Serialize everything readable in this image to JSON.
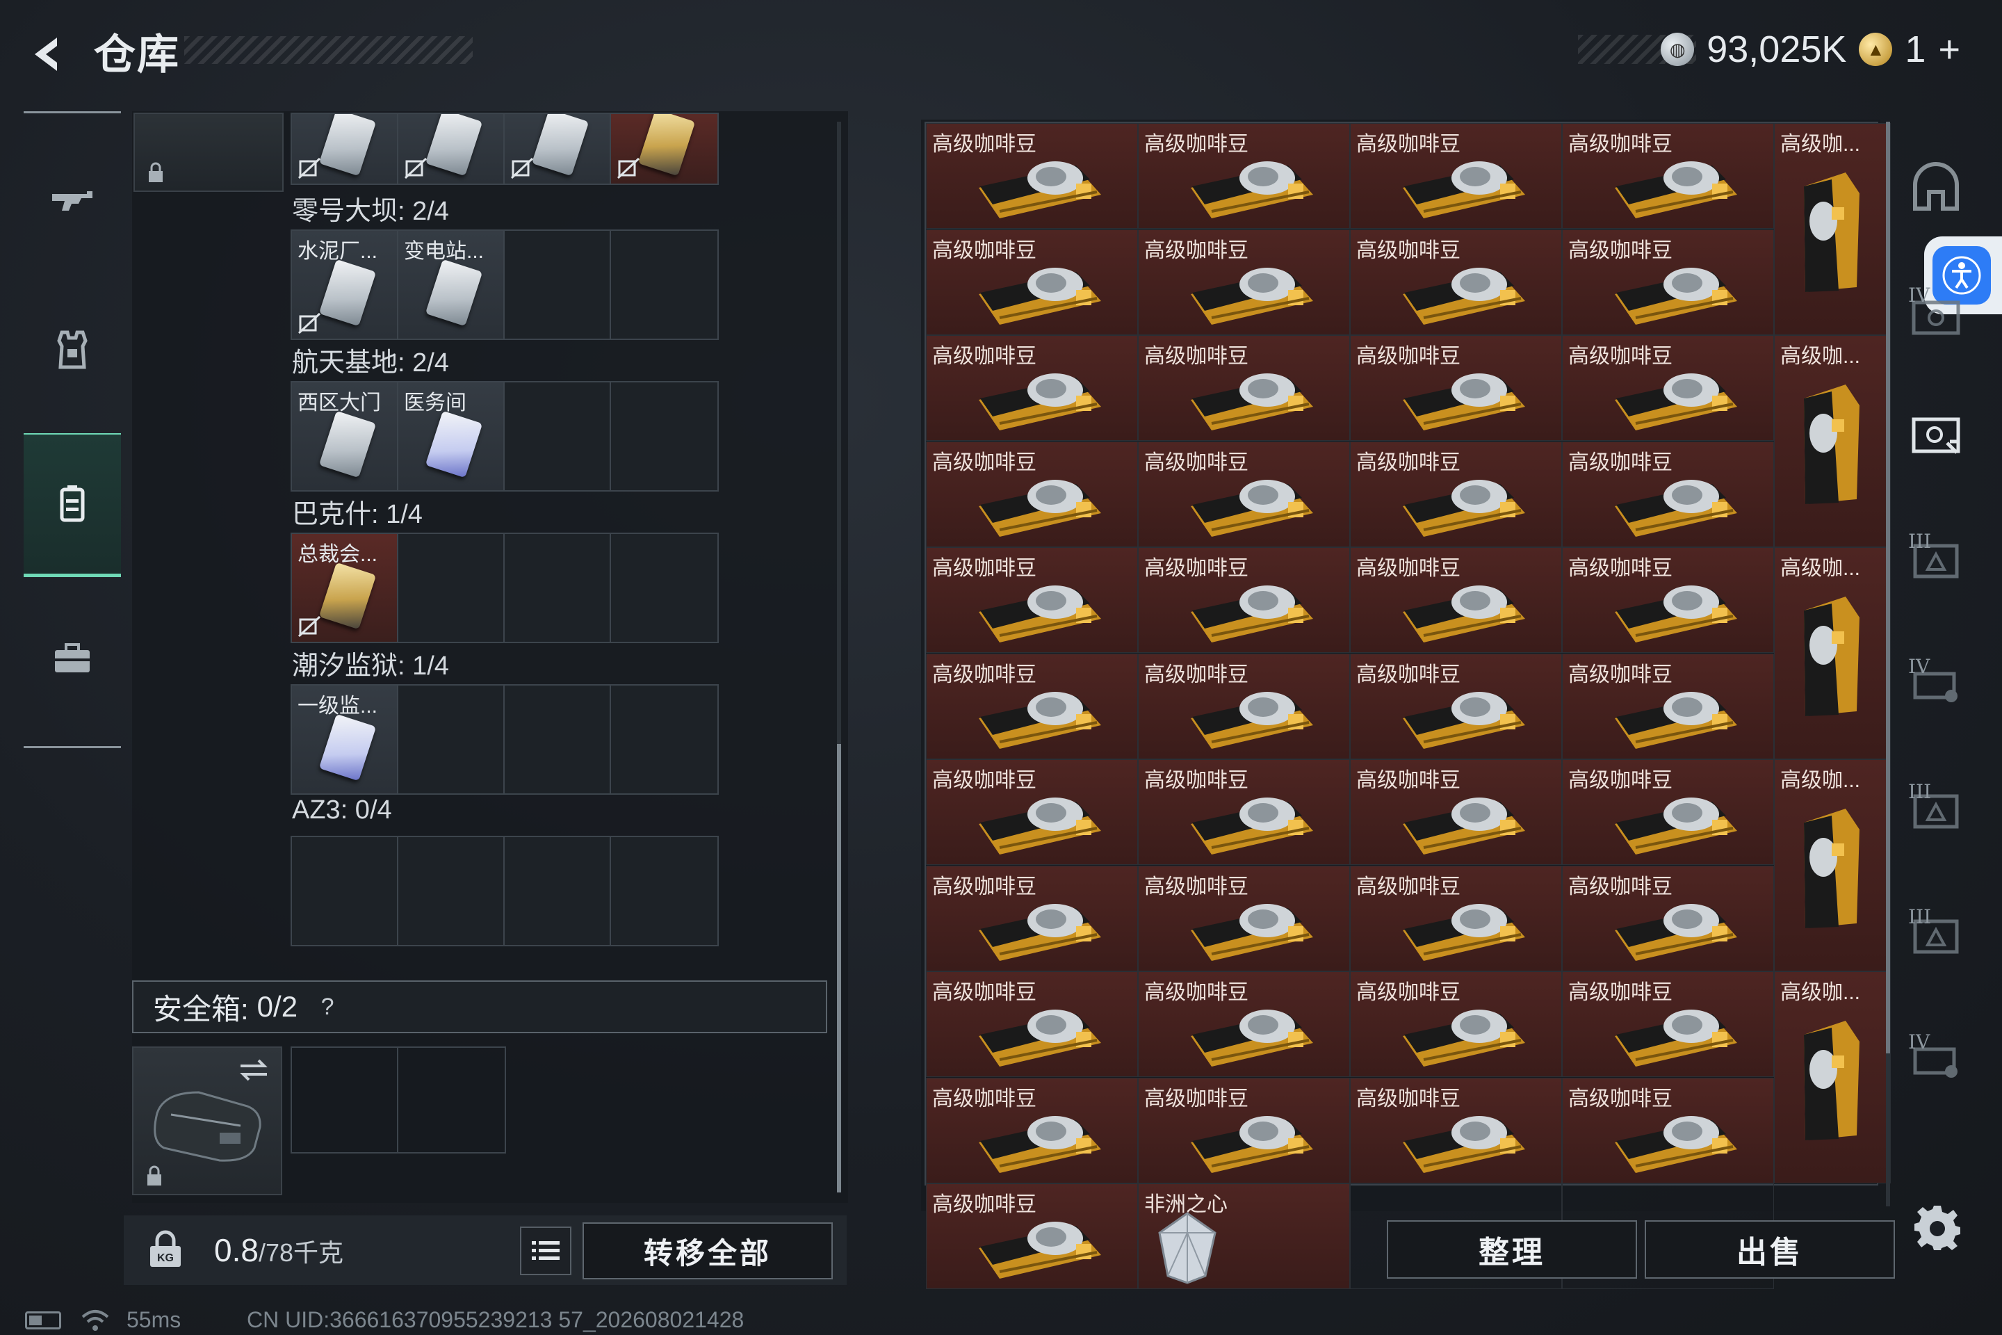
{
  "header": {
    "title": "仓库",
    "currency_amount": "93,025K",
    "premium_amount": "1",
    "premium_plus": "+"
  },
  "left_nav": {
    "items": [
      {
        "id": "weapons",
        "icon": "rifle-icon"
      },
      {
        "id": "armor",
        "icon": "vest-icon"
      },
      {
        "id": "backpack",
        "icon": "backpack-icon",
        "active": true
      },
      {
        "id": "cases",
        "icon": "briefcase-icon"
      }
    ]
  },
  "keycard_groups": [
    {
      "label": "零号大坝: 2/4",
      "slots": [
        "水泥厂...",
        "变电站..."
      ]
    },
    {
      "label": "航天基地: 2/4",
      "slots": [
        "西区大门",
        "医务间"
      ]
    },
    {
      "label": "巴克什: 1/4",
      "slots": [
        "总裁会..."
      ]
    },
    {
      "label": "潮汐监狱: 1/4",
      "slots": [
        "一级监..."
      ]
    },
    {
      "label": "AZ3: 0/4",
      "slots": []
    }
  ],
  "safebox": {
    "label": "安全箱:",
    "count": "0/2",
    "help": "?"
  },
  "weight": {
    "current": "0.8",
    "max": "/78千克"
  },
  "buttons": {
    "transfer_all": "转移全部",
    "organize": "整理",
    "sell": "出售"
  },
  "grid_items": {
    "coffee_bag_label": "高级咖啡豆",
    "coffee_tall_label": "高级咖...",
    "gem_label": "非洲之心",
    "coffee_rows": 10,
    "coffee_cols": 4,
    "last_row_coffee_count": 1,
    "tall_items_count": 5
  },
  "side_tiers": [
    "IV",
    "III",
    "IV",
    "III",
    "III",
    "IV"
  ],
  "status_bar": {
    "ping": "55ms",
    "uid": "CN UID:366616370955239213 57_202608021428"
  },
  "colors": {
    "accent_green": "#6fd9b6",
    "item_red": "#4e2522",
    "access_blue": "#2d7cf6"
  }
}
